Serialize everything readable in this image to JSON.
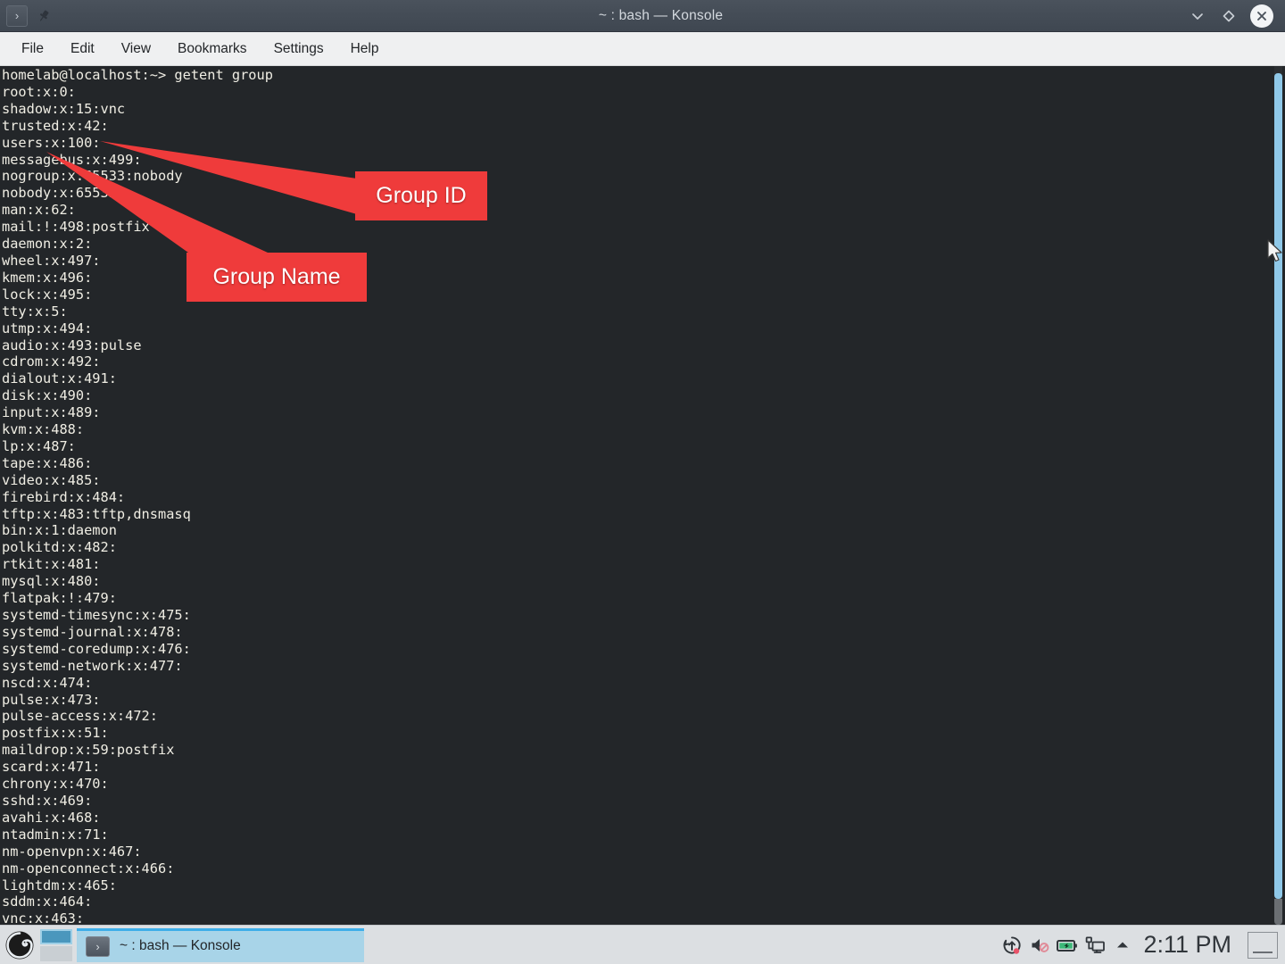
{
  "window": {
    "title": "~ : bash — Konsole",
    "app_icon": "konsole-icon",
    "pin_icon": "pin-icon",
    "controls": [
      {
        "name": "minimize-button",
        "icon": "chevron-down-icon"
      },
      {
        "name": "maximize-button",
        "icon": "diamond-icon"
      },
      {
        "name": "close-button",
        "icon": "close-x-icon"
      }
    ]
  },
  "menubar": {
    "items": [
      "File",
      "Edit",
      "View",
      "Bookmarks",
      "Settings",
      "Help"
    ]
  },
  "terminal": {
    "prompt": "homelab@localhost:~>",
    "command": "getent group",
    "prompt_line": "homelab@localhost:~> getent group",
    "lines": [
      "homelab@localhost:~> getent group",
      "root:x:0:",
      "shadow:x:15:vnc",
      "trusted:x:42:",
      "users:x:100:",
      "messagebus:x:499:",
      "nogroup:x:65533:nobody",
      "nobody:x:65533:",
      "man:x:62:",
      "mail:!:498:postfix",
      "daemon:x:2:",
      "wheel:x:497:",
      "kmem:x:496:",
      "lock:x:495:",
      "tty:x:5:",
      "utmp:x:494:",
      "audio:x:493:pulse",
      "cdrom:x:492:",
      "dialout:x:491:",
      "disk:x:490:",
      "input:x:489:",
      "kvm:x:488:",
      "lp:x:487:",
      "tape:x:486:",
      "video:x:485:",
      "firebird:x:484:",
      "tftp:x:483:tftp,dnsmasq",
      "bin:x:1:daemon",
      "polkitd:x:482:",
      "rtkit:x:481:",
      "mysql:x:480:",
      "flatpak:!:479:",
      "systemd-timesync:x:475:",
      "systemd-journal:x:478:",
      "systemd-coredump:x:476:",
      "systemd-network:x:477:",
      "nscd:x:474:",
      "pulse:x:473:",
      "pulse-access:x:472:",
      "postfix:x:51:",
      "maildrop:x:59:postfix",
      "scard:x:471:",
      "chrony:x:470:",
      "sshd:x:469:",
      "avahi:x:468:",
      "ntadmin:x:71:",
      "nm-openvpn:x:467:",
      "nm-openconnect:x:466:",
      "lightdm:x:465:",
      "sddm:x:464:",
      "vnc:x:463:"
    ],
    "background_color": "#232629",
    "text_color": "#f0eee4"
  },
  "annotations": {
    "color": "#ef3b3b",
    "text_color": "#ffffff",
    "callouts": [
      {
        "label": "Group ID",
        "points_at": "100"
      },
      {
        "label": "Group Name",
        "points_at": "users"
      }
    ]
  },
  "taskbar": {
    "launcher_icon": "opensuse-chameleon-icon",
    "pager": {
      "active_desktop": 1,
      "desktops": 2
    },
    "tasks": [
      {
        "label": "~ : bash — Konsole",
        "icon": "konsole-icon",
        "active": true
      }
    ],
    "tray": [
      {
        "name": "software-update-icon",
        "glyph": "update"
      },
      {
        "name": "volume-muted-icon",
        "glyph": "speaker-muted"
      },
      {
        "name": "battery-charging-icon",
        "glyph": "battery"
      },
      {
        "name": "network-wired-icon",
        "glyph": "display-network"
      },
      {
        "name": "show-hidden-icons-icon",
        "glyph": "chevron-up"
      }
    ],
    "clock": "2:11 PM",
    "show_desktop": "show-desktop-button",
    "accent_color": "#3daee9",
    "background_color": "#dcdfe2"
  }
}
